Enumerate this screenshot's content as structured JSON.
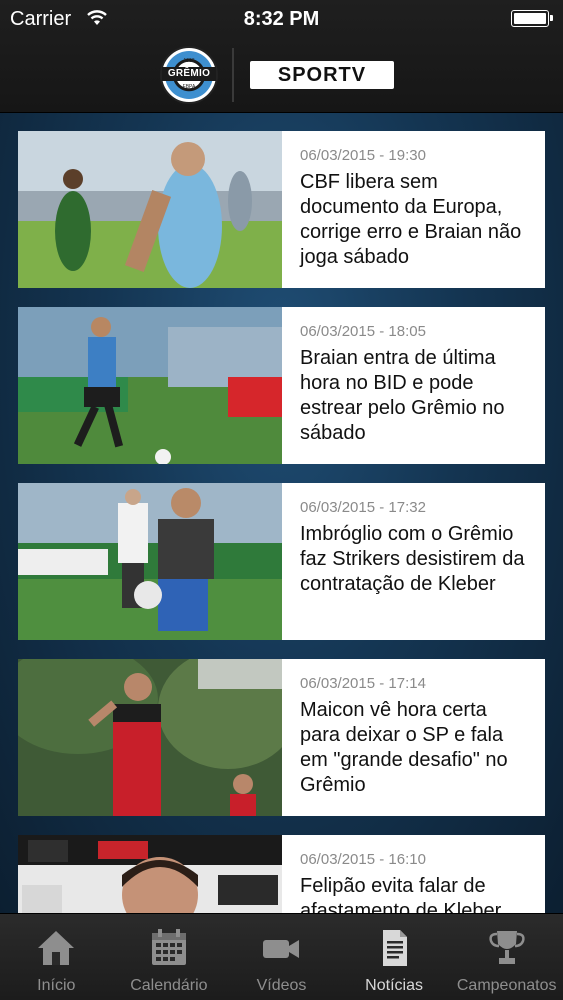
{
  "status_bar": {
    "carrier": "Carrier",
    "time": "8:32 PM"
  },
  "header": {
    "club_logo_text": "GRÊMIO",
    "club_logo_year": "1903",
    "club_logo_city": "FBPA",
    "partner_logo_text": "SPORTV"
  },
  "news": [
    {
      "date": "06/03/2015 - 19:30",
      "title": "CBF libera sem documento da Europa, corrige erro e Braian não joga sábado"
    },
    {
      "date": "06/03/2015 - 18:05",
      "title": "Braian entra de última hora no BID e pode estrear pelo Grêmio no sábado"
    },
    {
      "date": "06/03/2015 - 17:32",
      "title": "Imbróglio com o Grêmio faz Strikers desistirem da contratação de Kleber"
    },
    {
      "date": "06/03/2015 - 17:14",
      "title": "Maicon vê hora certa para deixar o SP e fala em \"grande desafio\" no Grêmio"
    },
    {
      "date": "06/03/2015 - 16:10",
      "title": "Felipão evita falar de afastamento de Kleber"
    }
  ],
  "tabs": [
    {
      "label": "Início",
      "icon": "house-icon"
    },
    {
      "label": "Calendário",
      "icon": "calendar-icon"
    },
    {
      "label": "Vídeos",
      "icon": "video-camera-icon"
    },
    {
      "label": "Notícias",
      "icon": "document-icon",
      "active": true
    },
    {
      "label": "Campeonatos",
      "icon": "trophy-icon"
    }
  ],
  "colors": {
    "header_bg": "#1f1f1f",
    "content_bg": "#1f4d74",
    "tab_inactive": "#8e8e8e",
    "tab_active": "#d8d8d8"
  }
}
